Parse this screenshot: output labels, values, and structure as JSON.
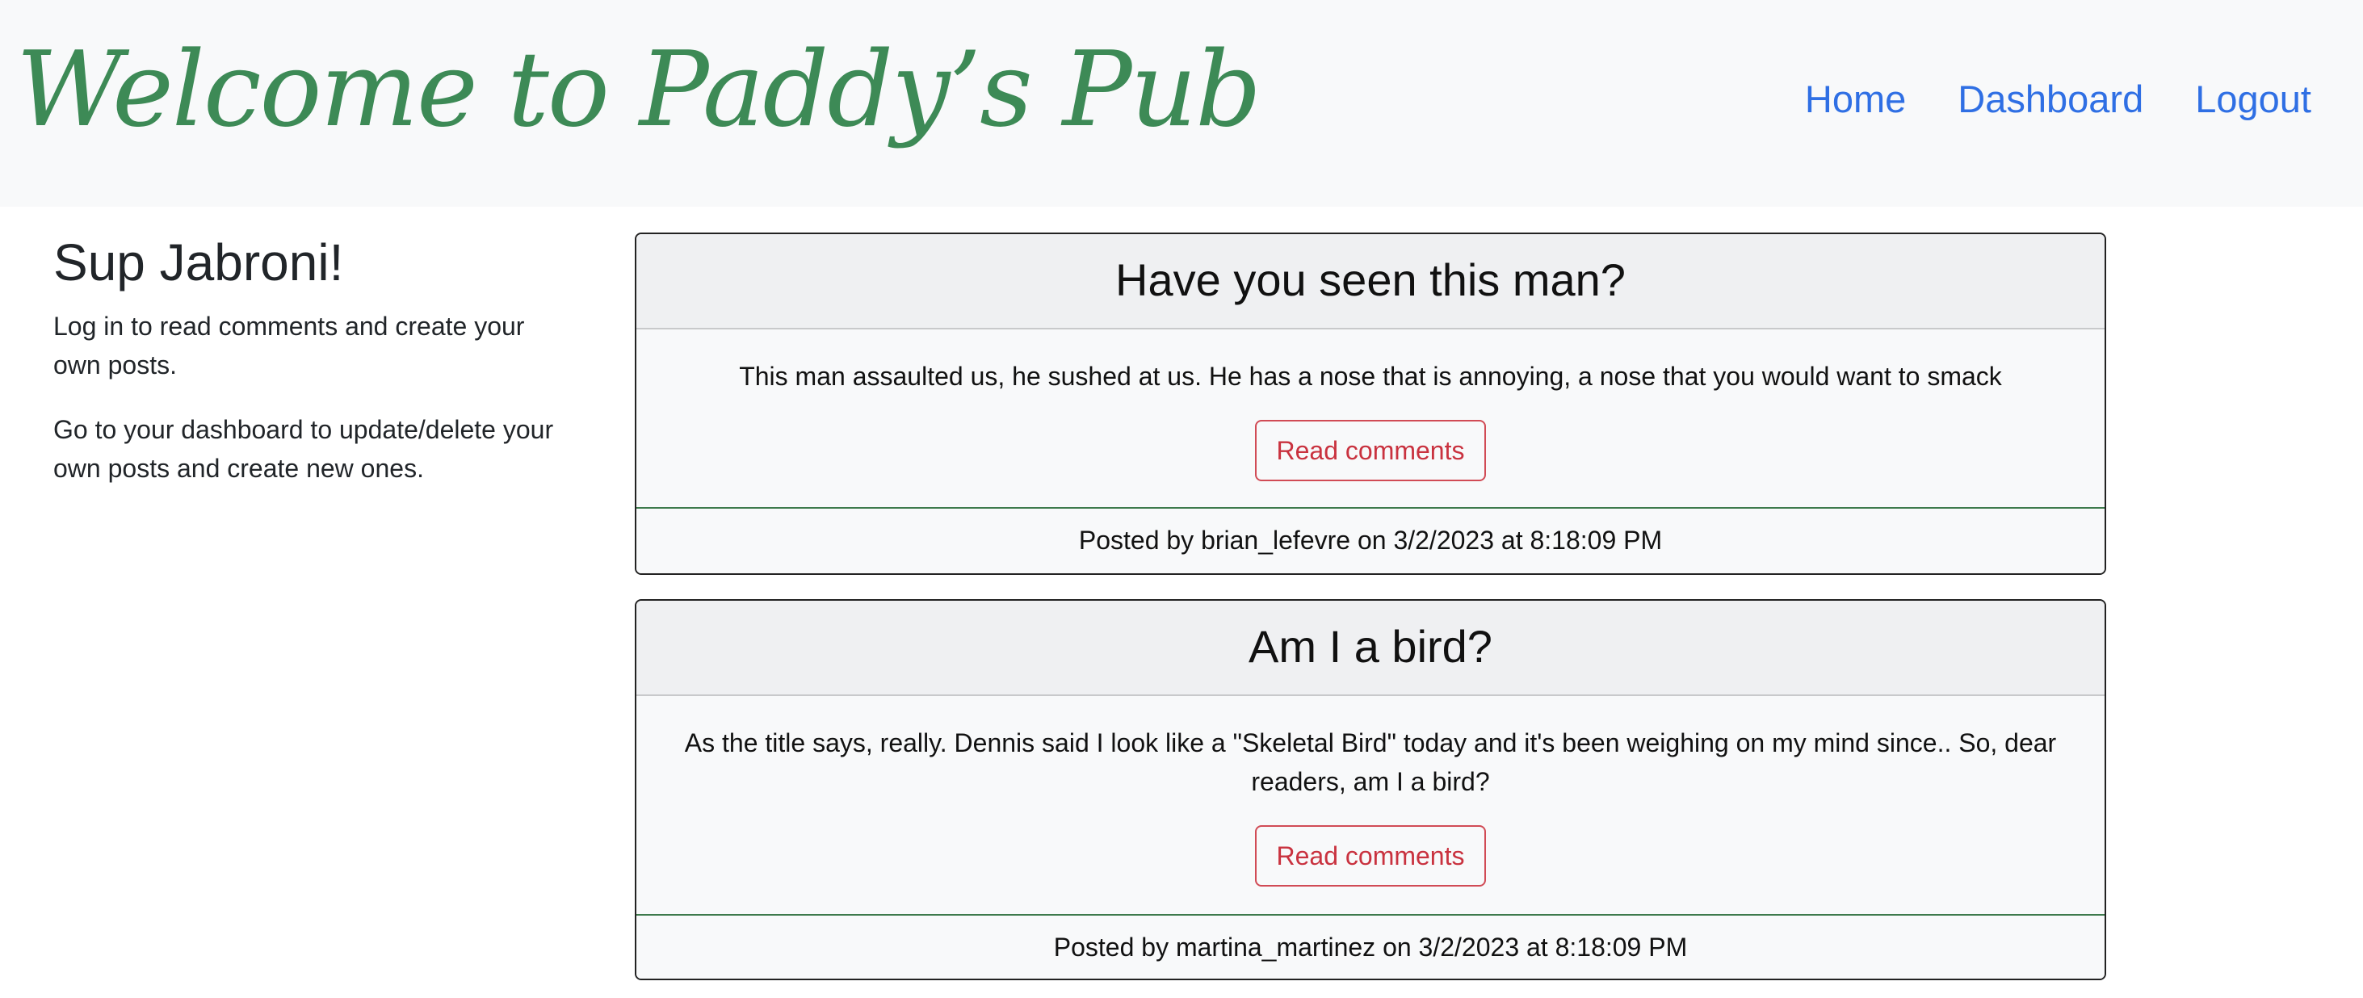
{
  "header": {
    "title": "Welcome to Paddy’s Pub",
    "nav": [
      "Home",
      "Dashboard",
      "Logout"
    ]
  },
  "sidebar": {
    "heading": "Sup Jabroni!",
    "paragraphs": [
      "Log in to read comments and create your own posts.",
      "Go to your dashboard to update/delete your own posts and create new ones."
    ]
  },
  "posts": [
    {
      "title": "Have you seen this man?",
      "body": "This man assaulted us, he sushed at us. He has a nose that is annoying, a nose that you would want to smack",
      "button": "Read comments",
      "footer": "Posted by brian_lefevre on 3/2/2023 at 8:18:09 PM"
    },
    {
      "title": "Am I a bird?",
      "body": "As the title says, really. Dennis said I look like a \"Skeletal Bird\" today and it's been weighing on my mind since.. So, dear readers, am I a bird?",
      "button": "Read comments",
      "footer": "Posted by martina_martinez on 3/2/2023 at 8:18:09 PM"
    }
  ],
  "colors": {
    "title": "#3d8a56",
    "nav_link": "#2f6fe4",
    "button": "#c9323f",
    "footer_border": "#3d7a4c"
  }
}
